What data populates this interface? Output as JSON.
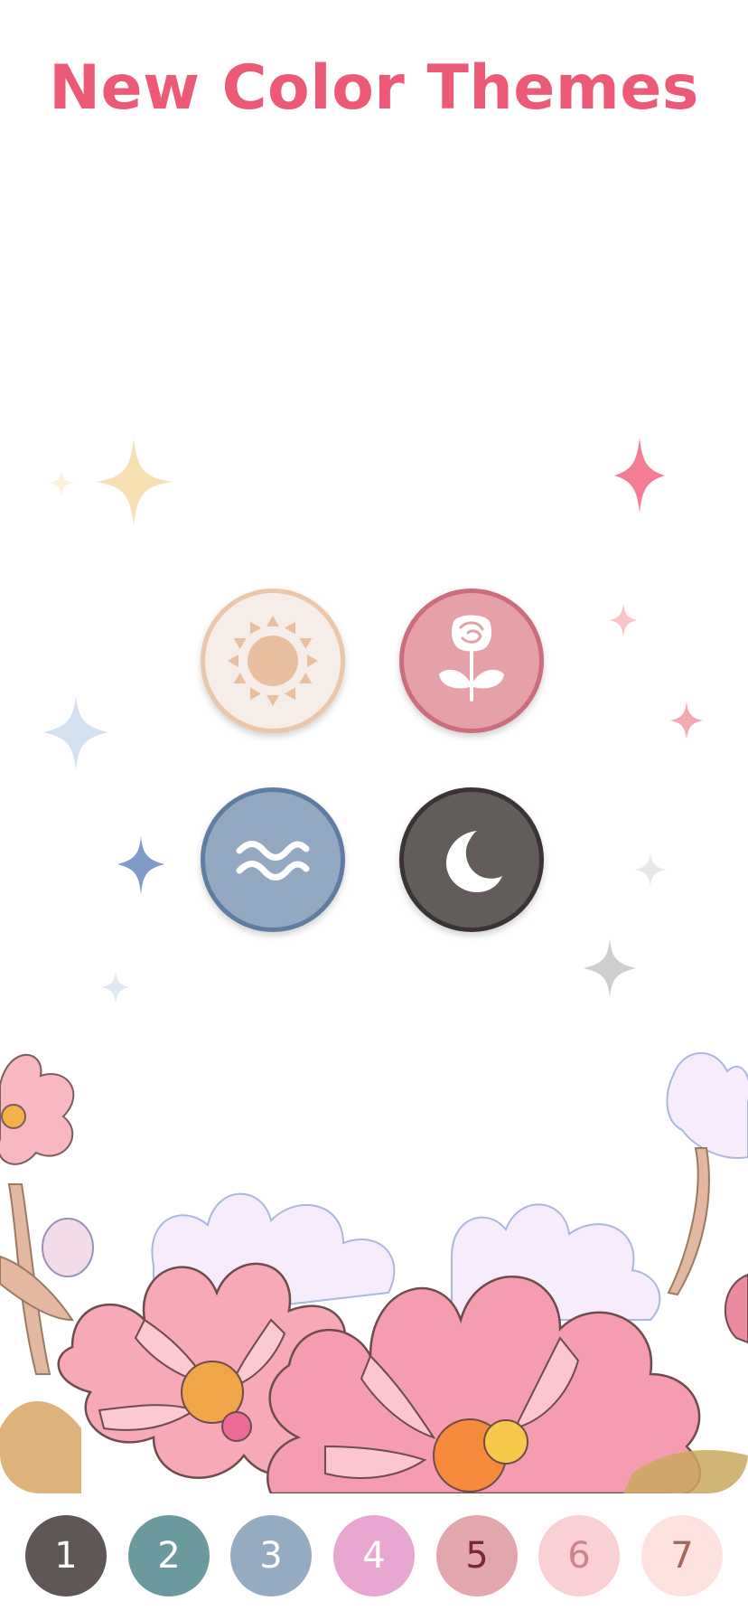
{
  "header": {
    "title": "New Color Themes"
  },
  "themes": [
    {
      "name": "sun",
      "icon": "sun-icon"
    },
    {
      "name": "rose",
      "icon": "rose-icon"
    },
    {
      "name": "wave",
      "icon": "waves-icon"
    },
    {
      "name": "moon",
      "icon": "moon-icon"
    }
  ],
  "palette": [
    {
      "label": "1",
      "bg": "#5e5756",
      "fg": "#ffffff"
    },
    {
      "label": "2",
      "bg": "#6b9a9e",
      "fg": "#ffffff"
    },
    {
      "label": "3",
      "bg": "#95abc2",
      "fg": "#ffffff"
    },
    {
      "label": "4",
      "bg": "#e7a7d0",
      "fg": "#ffffff"
    },
    {
      "label": "5",
      "bg": "#e2a6ad",
      "fg": "#7a2835"
    },
    {
      "label": "6",
      "bg": "#fbd0d4",
      "fg": "#c9858e"
    },
    {
      "label": "7",
      "bg": "#fde2e0",
      "fg": "#a2685c"
    }
  ]
}
